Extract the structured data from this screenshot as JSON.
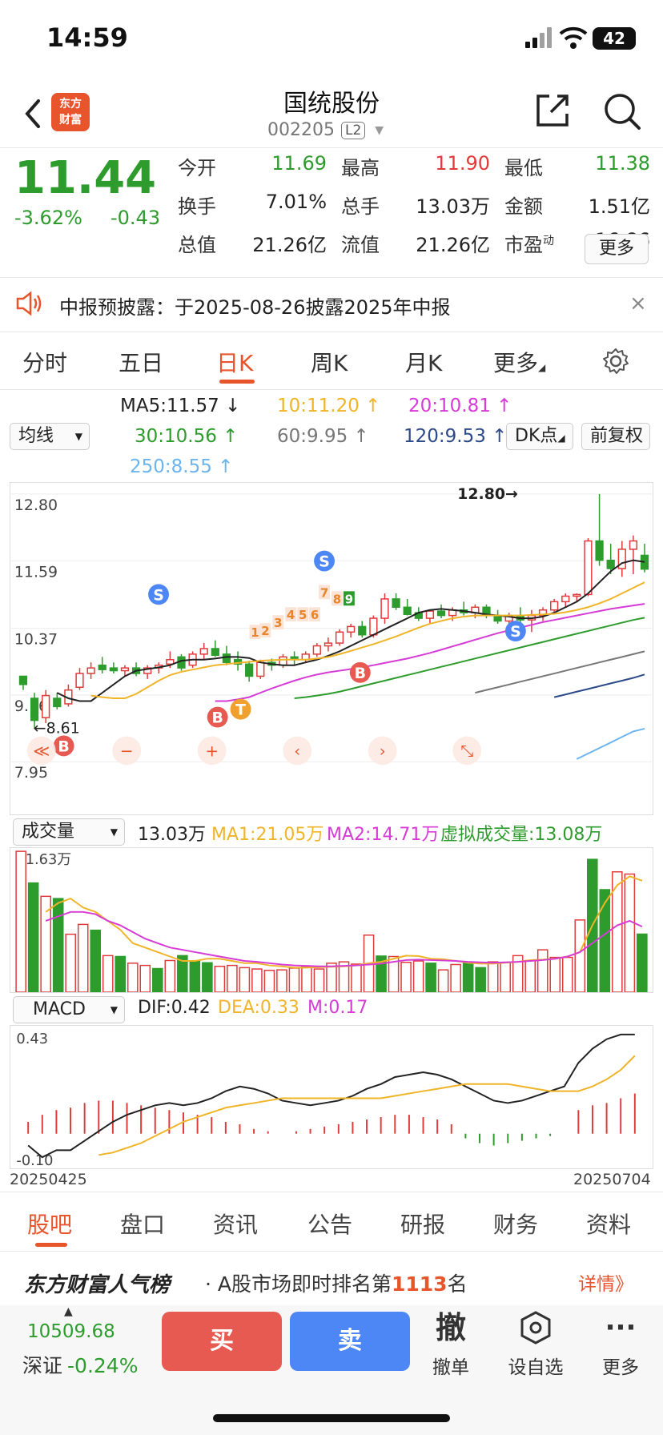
{
  "status_bar": {
    "time": "14:59",
    "battery": "42"
  },
  "header": {
    "logo_line1": "东方",
    "logo_line2": "财富",
    "stock_name": "国统股份",
    "stock_code": "002205",
    "level_badge": "L2"
  },
  "quote": {
    "price": "11.44",
    "change_pct": "-3.62%",
    "change": "-0.43",
    "fields": [
      {
        "label": "今开",
        "value": "11.69",
        "color": "#2d9c2d"
      },
      {
        "label": "最高",
        "value": "11.90",
        "color": "#e03a3a"
      },
      {
        "label": "最低",
        "value": "11.38",
        "color": "#2d9c2d"
      },
      {
        "label": "换手",
        "value": "7.01%",
        "color": "#222222"
      },
      {
        "label": "总手",
        "value": "13.03万",
        "color": "#222222"
      },
      {
        "label": "金额",
        "value": "1.51亿",
        "color": "#222222"
      },
      {
        "label": "总值",
        "value": "21.26亿",
        "color": "#222222"
      },
      {
        "label": "流值",
        "value": "21.26亿",
        "color": "#222222"
      },
      {
        "label": "市盈",
        "value": "-16.86",
        "color": "#222222"
      }
    ],
    "pe_superscript": "动",
    "more_label": "更多"
  },
  "notice": {
    "text": "中报预披露：于2025-08-26披露2025年中报",
    "close": "×"
  },
  "period_tabs": [
    "分时",
    "五日",
    "日K",
    "周K",
    "月K",
    "更多"
  ],
  "ma": {
    "selector": "均线",
    "ma5": "MA5:11.57 ↓",
    "ma10": "10:11.20 ↑",
    "ma20": "20:10.81 ↑",
    "ma30": "30:10.56 ↑",
    "ma60": "60:9.95 ↑",
    "ma120": "120:9.53 ↑",
    "ma250": "250:8.55 ↑",
    "dk_button": "DK点",
    "adjust_button": "前复权"
  },
  "volume_row": {
    "selector": "成交量",
    "value": "13.03万",
    "ma1": "MA1:21.05万",
    "ma2": "MA2:14.71万",
    "virtual": "虚拟成交量:13.08万"
  },
  "macd_row": {
    "selector": "MACD",
    "dif": "DIF:0.42",
    "dea": "DEA:0.33",
    "m": "M:0.17"
  },
  "chart_data": [
    {
      "type": "candlestick",
      "title": "",
      "y_ticks": [
        "12.80",
        "11.59",
        "10.37",
        "9.16",
        "7.95"
      ],
      "ylim": [
        7.95,
        12.8
      ],
      "annotations": [
        "12.80→",
        "←8.61"
      ],
      "trade_markers": [
        "S",
        "S",
        "S",
        "B",
        "B",
        "B",
        "T"
      ],
      "count_labels": [
        "1",
        "2",
        "3",
        "4",
        "5",
        "6",
        "7",
        "8",
        "9"
      ],
      "ohlc": [
        [
          9.5,
          9.5,
          9.25,
          9.35
        ],
        [
          9.1,
          9.2,
          8.55,
          8.7
        ],
        [
          8.75,
          9.25,
          8.65,
          9.15
        ],
        [
          9.1,
          9.2,
          8.9,
          8.95
        ],
        [
          9.0,
          9.35,
          8.95,
          9.25
        ],
        [
          9.3,
          9.65,
          9.25,
          9.55
        ],
        [
          9.55,
          9.75,
          9.45,
          9.65
        ],
        [
          9.7,
          9.85,
          9.55,
          9.62
        ],
        [
          9.65,
          9.75,
          9.55,
          9.6
        ],
        [
          9.6,
          9.7,
          9.5,
          9.65
        ],
        [
          9.65,
          9.75,
          9.5,
          9.55
        ],
        [
          9.55,
          9.7,
          9.45,
          9.65
        ],
        [
          9.65,
          9.75,
          9.55,
          9.7
        ],
        [
          9.72,
          9.95,
          9.65,
          9.8
        ],
        [
          9.85,
          9.9,
          9.6,
          9.65
        ],
        [
          9.7,
          9.95,
          9.65,
          9.9
        ],
        [
          9.9,
          10.1,
          9.8,
          10.0
        ],
        [
          10.0,
          10.15,
          9.85,
          9.88
        ],
        [
          9.9,
          10.05,
          9.7,
          9.75
        ],
        [
          9.8,
          9.95,
          9.6,
          9.72
        ],
        [
          9.72,
          9.78,
          9.4,
          9.5
        ],
        [
          9.5,
          9.8,
          9.45,
          9.75
        ],
        [
          9.75,
          9.82,
          9.6,
          9.7
        ],
        [
          9.7,
          9.9,
          9.65,
          9.85
        ],
        [
          9.85,
          9.95,
          9.7,
          9.8
        ],
        [
          9.8,
          9.95,
          9.75,
          9.9
        ],
        [
          9.9,
          10.1,
          9.85,
          10.05
        ],
        [
          10.05,
          10.2,
          9.95,
          10.1
        ],
        [
          10.1,
          10.35,
          10.05,
          10.3
        ],
        [
          10.3,
          10.45,
          10.2,
          10.4
        ],
        [
          10.4,
          10.5,
          10.2,
          10.25
        ],
        [
          10.25,
          10.6,
          10.2,
          10.55
        ],
        [
          10.55,
          11.0,
          10.45,
          10.9
        ],
        [
          10.9,
          11.0,
          10.7,
          10.75
        ],
        [
          10.75,
          10.9,
          10.6,
          10.62
        ],
        [
          10.65,
          10.75,
          10.5,
          10.55
        ],
        [
          10.55,
          10.7,
          10.45,
          10.68
        ],
        [
          10.68,
          10.8,
          10.55,
          10.6
        ],
        [
          10.6,
          10.75,
          10.5,
          10.7
        ],
        [
          10.7,
          10.85,
          10.6,
          10.65
        ],
        [
          10.65,
          10.8,
          10.55,
          10.75
        ],
        [
          10.75,
          10.8,
          10.55,
          10.6
        ],
        [
          10.6,
          10.7,
          10.45,
          10.5
        ],
        [
          10.5,
          10.65,
          10.4,
          10.6
        ],
        [
          10.6,
          10.75,
          10.45,
          10.52
        ],
        [
          10.52,
          10.7,
          10.3,
          10.6
        ],
        [
          10.6,
          10.75,
          10.5,
          10.7
        ],
        [
          10.7,
          10.9,
          10.65,
          10.85
        ],
        [
          10.85,
          11.0,
          10.75,
          10.95
        ],
        [
          10.95,
          11.0,
          10.85,
          10.98
        ],
        [
          10.98,
          12.0,
          10.95,
          11.95
        ],
        [
          11.95,
          12.8,
          11.5,
          11.6
        ],
        [
          11.6,
          11.9,
          11.35,
          11.45
        ],
        [
          11.45,
          11.95,
          11.3,
          11.8
        ],
        [
          11.8,
          12.05,
          11.35,
          11.95
        ],
        [
          11.69,
          11.9,
          11.38,
          11.44
        ]
      ],
      "ma_series": [
        {
          "name": "MA5",
          "color": "#222222",
          "values": [
            9.2,
            9.1,
            9.05,
            9.05,
            9.2,
            9.35,
            9.5,
            9.6,
            9.63,
            9.66,
            9.7,
            9.78,
            9.8,
            9.8,
            9.82,
            9.85,
            9.85,
            9.83,
            9.75,
            9.72,
            9.7,
            9.7,
            9.75,
            9.8,
            9.87,
            9.95,
            10.05,
            10.15,
            10.25,
            10.35,
            10.45,
            10.55,
            10.65,
            10.7,
            10.72,
            10.7,
            10.68,
            10.65,
            10.62,
            10.6,
            10.58,
            10.55,
            10.55,
            10.58,
            10.65,
            10.75,
            10.85,
            11.0,
            11.2,
            11.4,
            11.55,
            11.6,
            11.57
          ]
        },
        {
          "name": "MA10",
          "color": "#f0b429",
          "values": [
            9.15,
            9.12,
            9.1,
            9.1,
            9.18,
            9.3,
            9.42,
            9.52,
            9.58,
            9.62,
            9.66,
            9.7,
            9.72,
            9.74,
            9.76,
            9.78,
            9.79,
            9.8,
            9.8,
            9.8,
            9.82,
            9.85,
            9.9,
            9.96,
            10.02,
            10.08,
            10.15,
            10.22,
            10.3,
            10.38,
            10.45,
            10.5,
            10.55,
            10.58,
            10.6,
            10.6,
            10.6,
            10.6,
            10.6,
            10.61,
            10.62,
            10.63,
            10.66,
            10.7,
            10.75,
            10.82,
            10.9,
            11.0,
            11.1,
            11.2
          ]
        },
        {
          "name": "MA20",
          "color": "#d63bd6",
          "values": [
            9.05,
            9.05,
            9.08,
            9.12,
            9.2,
            9.28,
            9.35,
            9.42,
            9.48,
            9.53,
            9.57,
            9.6,
            9.63,
            9.66,
            9.7,
            9.74,
            9.78,
            9.82,
            9.87,
            9.92,
            9.98,
            10.04,
            10.1,
            10.16,
            10.22,
            10.28,
            10.33,
            10.38,
            10.43,
            10.48,
            10.52,
            10.56,
            10.6,
            10.64,
            10.68,
            10.72,
            10.75,
            10.78,
            10.81
          ]
        },
        {
          "name": "MA30",
          "color": "#2d9c2d",
          "values": [
            9.1,
            9.12,
            9.15,
            9.18,
            9.22,
            9.27,
            9.32,
            9.37,
            9.42,
            9.47,
            9.52,
            9.57,
            9.62,
            9.67,
            9.72,
            9.77,
            9.82,
            9.87,
            9.92,
            9.97,
            10.02,
            10.07,
            10.12,
            10.17,
            10.22,
            10.27,
            10.32,
            10.37,
            10.42,
            10.47,
            10.52,
            10.56
          ]
        },
        {
          "name": "MA60",
          "color": "#777777",
          "values": [
            9.2,
            9.25,
            9.3,
            9.35,
            9.4,
            9.45,
            9.5,
            9.55,
            9.6,
            9.65,
            9.7,
            9.75,
            9.8,
            9.85,
            9.9,
            9.95
          ]
        },
        {
          "name": "MA120",
          "color": "#2c4a8a",
          "values": [
            9.12,
            9.17,
            9.22,
            9.27,
            9.32,
            9.37,
            9.42,
            9.47,
            9.53
          ]
        },
        {
          "name": "MA250",
          "color": "#6cb4ee",
          "values": [
            8.0,
            8.1,
            8.2,
            8.3,
            8.4,
            8.5,
            8.55
          ]
        }
      ]
    },
    {
      "type": "bar",
      "title": "成交量",
      "y_ticks": [
        "31.63万"
      ],
      "ylim": [
        0,
        31.63
      ],
      "values": [
        31.6,
        24.5,
        21.5,
        21.0,
        13.0,
        15.2,
        13.9,
        8.2,
        8.0,
        6.5,
        6.0,
        5.3,
        7.1,
        8.2,
        7.0,
        6.6,
        5.8,
        6.0,
        5.5,
        5.2,
        4.9,
        5.0,
        5.4,
        5.8,
        5.2,
        6.5,
        6.8,
        6.3,
        12.8,
        8.1,
        8.0,
        6.7,
        7.0,
        6.5,
        5.0,
        6.2,
        6.5,
        5.5,
        6.8,
        6.7,
        8.2,
        7.1,
        9.5,
        7.8,
        7.8,
        16.2,
        29.8,
        23.0,
        27.0,
        26.5,
        13.03
      ],
      "colors": [
        "r",
        "g",
        "r",
        "g",
        "r",
        "r",
        "g",
        "r",
        "g",
        "r",
        "r",
        "g",
        "r",
        "g",
        "g",
        "g",
        "r",
        "r",
        "r",
        "r",
        "r",
        "r",
        "r",
        "r",
        "r",
        "r",
        "r",
        "r",
        "r",
        "g",
        "r",
        "r",
        "r",
        "g",
        "r",
        "r",
        "g",
        "g",
        "r",
        "r",
        "r",
        "r",
        "r",
        "r",
        "r",
        "r",
        "g",
        "g",
        "r",
        "r",
        "g"
      ],
      "ma1": [
        18,
        20,
        21,
        19,
        18,
        16,
        14,
        11,
        10,
        9,
        8,
        7,
        7,
        7.5,
        7.5,
        7,
        6.5,
        6.5,
        6,
        5.8,
        5.5,
        5.5,
        5.6,
        5.7,
        5.8,
        6,
        6.5,
        6.8,
        7.5,
        8.2,
        8.1,
        7.5,
        7.4,
        7,
        6.6,
        6.4,
        6.4,
        6.6,
        6.8,
        7.2,
        7.3,
        7.5,
        8,
        9,
        15,
        20,
        24,
        26,
        25
      ],
      "ma2": [
        16,
        17,
        18,
        18,
        17.5,
        16,
        15,
        13.5,
        12,
        11,
        10,
        9.5,
        9,
        8.5,
        8,
        7.5,
        7,
        6.8,
        6.5,
        6.2,
        6,
        5.9,
        5.8,
        5.8,
        5.9,
        6,
        6.2,
        6.4,
        6.8,
        7.2,
        7.3,
        7.2,
        7.1,
        7,
        6.8,
        6.7,
        6.6,
        6.7,
        6.8,
        7,
        7.2,
        7.5,
        8,
        9,
        11,
        13,
        15,
        16,
        14.71
      ]
    },
    {
      "type": "bar",
      "title": "MACD",
      "x_labels": [
        "20250425",
        "20250704"
      ],
      "y_ticks": [
        "0.43",
        "-0.10"
      ],
      "ylim": [
        -0.12,
        0.43
      ],
      "histogram": [
        0.05,
        0.08,
        0.1,
        0.11,
        0.13,
        0.14,
        0.14,
        0.13,
        0.12,
        0.11,
        0.1,
        0.09,
        0.08,
        0.07,
        0.05,
        0.04,
        0.02,
        0.01,
        0.0,
        0.01,
        0.02,
        0.03,
        0.04,
        0.05,
        0.06,
        0.07,
        0.08,
        0.08,
        0.07,
        0.06,
        0.04,
        -0.02,
        -0.04,
        -0.05,
        -0.04,
        -0.03,
        -0.02,
        -0.01,
        0.0,
        0.1,
        0.12,
        0.13,
        0.15,
        0.17
      ],
      "dif": [
        -0.05,
        -0.1,
        -0.07,
        -0.07,
        -0.03,
        0.01,
        0.05,
        0.08,
        0.1,
        0.12,
        0.13,
        0.12,
        0.13,
        0.15,
        0.18,
        0.2,
        0.19,
        0.17,
        0.14,
        0.13,
        0.12,
        0.13,
        0.14,
        0.16,
        0.19,
        0.21,
        0.24,
        0.25,
        0.26,
        0.25,
        0.23,
        0.2,
        0.17,
        0.14,
        0.13,
        0.14,
        0.16,
        0.18,
        0.2,
        0.3,
        0.36,
        0.4,
        0.42,
        0.42
      ],
      "dea": [
        -0.09,
        -0.08,
        -0.06,
        -0.04,
        -0.01,
        0.02,
        0.05,
        0.07,
        0.09,
        0.11,
        0.12,
        0.13,
        0.14,
        0.15,
        0.15,
        0.15,
        0.15,
        0.15,
        0.15,
        0.15,
        0.15,
        0.16,
        0.17,
        0.18,
        0.19,
        0.2,
        0.21,
        0.21,
        0.21,
        0.21,
        0.2,
        0.19,
        0.18,
        0.18,
        0.18,
        0.2,
        0.23,
        0.27,
        0.33
      ]
    }
  ],
  "bottom_tabs": [
    "股吧",
    "盘口",
    "资讯",
    "公告",
    "研报",
    "财务",
    "资料"
  ],
  "rank": {
    "brand": "东方财富人气榜",
    "text": "· A股市场即时排名第",
    "number": "1113",
    "suffix": "名",
    "detail": "详情》"
  },
  "index": {
    "value": "10509.68",
    "name": "深证",
    "pct": "-0.24%"
  },
  "trade": {
    "buy": "买",
    "sell": "卖"
  },
  "tools": [
    {
      "icon": "撤",
      "label": "撤单"
    },
    {
      "icon": "◇",
      "label": "设自选"
    },
    {
      "icon": "···",
      "label": "更多"
    }
  ],
  "colors": {
    "up": "#e03a3a",
    "down": "#2d9c2d",
    "accent": "#e8542c"
  }
}
